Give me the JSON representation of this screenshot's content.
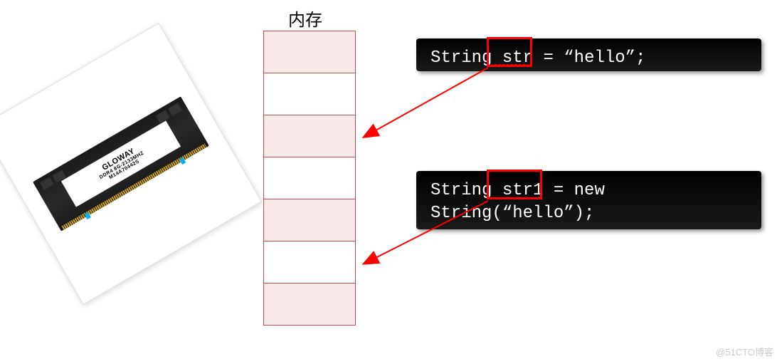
{
  "memory": {
    "title": "内存",
    "cell_count": 7,
    "shaded_indices": [
      0,
      2,
      4,
      6
    ]
  },
  "ram": {
    "brand": "GLOWAY",
    "spec": "DDR4 8G-2133MHZ",
    "serial": "M14A70442S"
  },
  "code": {
    "line1_type": "String",
    "line1_var": "str",
    "line1_assign": "= “hello”;",
    "line2a_type": "String",
    "line2a_var": "str1",
    "line2a_assign": "= new",
    "line2b": "String(“hello”);"
  },
  "watermark": "@51CTO博客"
}
